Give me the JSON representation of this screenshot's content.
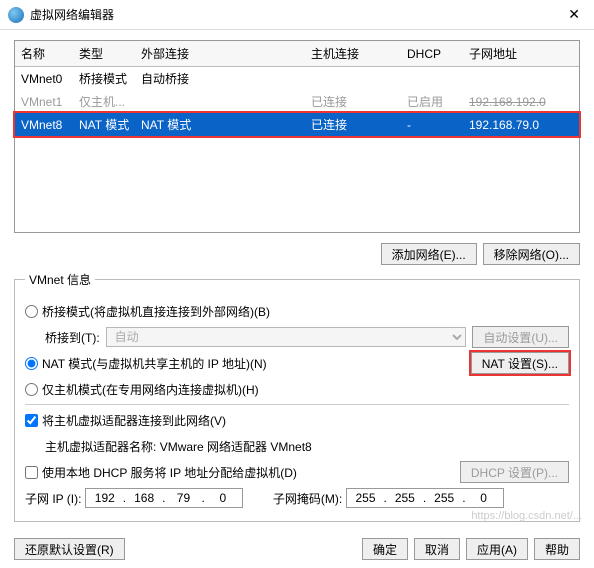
{
  "window": {
    "title": "虚拟网络编辑器",
    "close_glyph": "✕"
  },
  "table": {
    "headers": [
      "名称",
      "类型",
      "外部连接",
      "主机连接",
      "DHCP",
      "子网地址"
    ],
    "rows": [
      {
        "name": "VMnet0",
        "type": "桥接模式",
        "ext": "自动桥接",
        "host": "",
        "dhcp": "",
        "subnet": ""
      },
      {
        "name": "VMnet1",
        "type": "仅主机...",
        "ext": "",
        "host": "已连接",
        "dhcp": "已启用",
        "subnet": "192.168.192.0",
        "dim": true,
        "strike_subnet": true
      },
      {
        "name": "VMnet8",
        "type": "NAT 模式",
        "ext": "NAT 模式",
        "host": "已连接",
        "dhcp": "-",
        "subnet": "192.168.79.0",
        "selected": true
      }
    ]
  },
  "buttons": {
    "add_net": "添加网络(E)...",
    "remove_net": "移除网络(O)..."
  },
  "info": {
    "legend": "VMnet 信息",
    "bridge_label": "桥接模式(将虚拟机直接连接到外部网络)(B)",
    "bridge_to": "桥接到(T):",
    "bridge_sel": "自动",
    "auto_set": "自动设置(U)...",
    "nat_label": "NAT 模式(与虚拟机共享主机的 IP 地址)(N)",
    "nat_set": "NAT 设置(S)...",
    "host_label": "仅主机模式(在专用网络内连接虚拟机)(H)",
    "host_conn": "将主机虚拟适配器连接到此网络(V)",
    "adapter_name_lbl": "主机虚拟适配器名称:",
    "adapter_name": "VMware 网络适配器 VMnet8",
    "dhcp_label": "使用本地 DHCP 服务将 IP 地址分配给虚拟机(D)",
    "dhcp_set": "DHCP 设置(P)...",
    "subnet_ip_lbl": "子网 IP (I):",
    "subnet_ip": [
      "192",
      "168",
      "79",
      "0"
    ],
    "subnet_mask_lbl": "子网掩码(M):",
    "subnet_mask": [
      "255",
      "255",
      "255",
      "0"
    ]
  },
  "footer": {
    "restore": "还原默认设置(R)",
    "ok": "确定",
    "cancel": "取消",
    "apply": "应用(A)",
    "help": "帮助"
  },
  "watermark": "https://blog.csdn.net/..."
}
